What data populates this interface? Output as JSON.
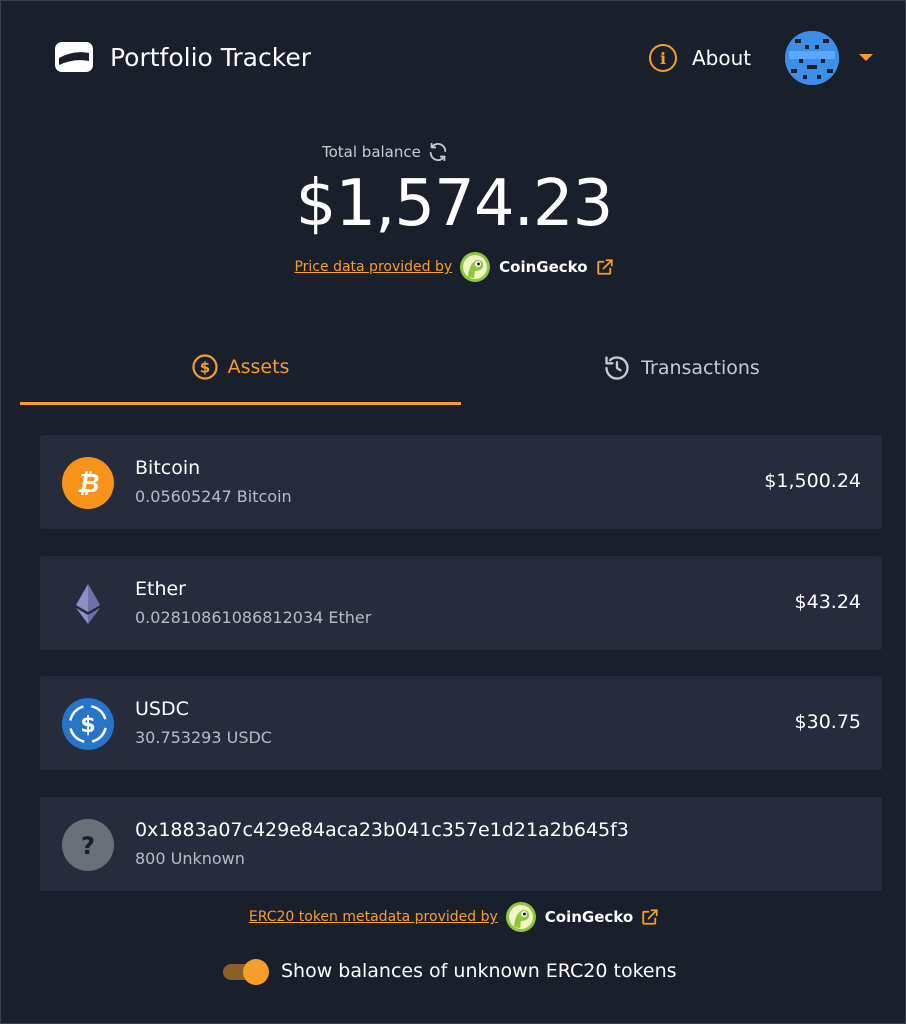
{
  "app": {
    "title": "Portfolio Tracker"
  },
  "header": {
    "about_label": "About"
  },
  "balance": {
    "label": "Total balance",
    "value": "$1,574.23",
    "provided_by_text": "Price data provided by",
    "provider_name": "CoinGecko"
  },
  "tabs": [
    {
      "label": "Assets",
      "active": true,
      "icon": "dollar-coin-icon"
    },
    {
      "label": "Transactions",
      "active": false,
      "icon": "history-icon"
    }
  ],
  "assets": [
    {
      "name": "Bitcoin",
      "amount": "0.05605247 Bitcoin",
      "value": "$1,500.24",
      "icon": "bitcoin-icon",
      "color": "#f7931a"
    },
    {
      "name": "Ether",
      "amount": "0.02810861086812034 Ether",
      "value": "$43.24",
      "icon": "ethereum-icon",
      "color": "#8c8fc5"
    },
    {
      "name": "USDC",
      "amount": "30.753293 USDC",
      "value": "$30.75",
      "icon": "usdc-icon",
      "color": "#2775ca"
    },
    {
      "name": "0x1883a07c429e84aca23b041c357e1d21a2b645f3",
      "amount": "800 Unknown",
      "value": "",
      "icon": "unknown-token-icon",
      "color": "#6b6f78"
    }
  ],
  "token_meta": {
    "provided_by_text": "ERC20 token metadata provided by",
    "provider_name": "CoinGecko"
  },
  "toggle": {
    "label": "Show balances of unknown ERC20 tokens",
    "checked": true
  },
  "colors": {
    "accent": "#f59e2b",
    "background": "#1a1f2c",
    "card": "#262c3b"
  }
}
